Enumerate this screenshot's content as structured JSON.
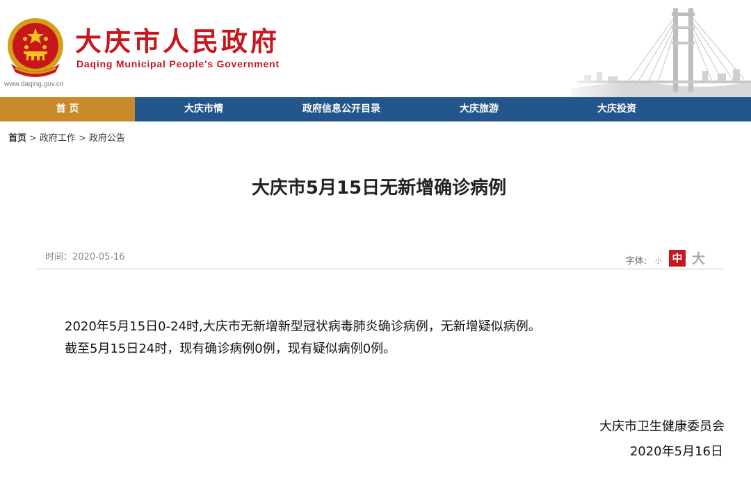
{
  "header": {
    "site_name_cn": "大庆市人民政府",
    "site_name_en": "Daqing Municipal People's Government",
    "site_url": "www.daqing.gov.cn",
    "brand_color": "#c8161d",
    "emblem_icon": "national-emblem-icon",
    "bridge_image": "bridge-illustration"
  },
  "nav": {
    "bg_color": "#23578c",
    "active_color": "#c98a2c",
    "items": [
      {
        "label": "首 页"
      },
      {
        "label": "大庆市情"
      },
      {
        "label": "政府信息公开目录"
      },
      {
        "label": "大庆旅游"
      },
      {
        "label": "大庆投资"
      }
    ]
  },
  "breadcrumb": {
    "items": [
      "首页",
      "政府工作",
      "政府公告"
    ],
    "separator": ">"
  },
  "article": {
    "title": "大庆市5月15日无新增确诊病例",
    "date_label": "时间：2020-05-16",
    "font_size_label": "字体:",
    "font_small": "小",
    "font_mid": "中",
    "font_big": "大",
    "paragraphs": [
      "2020年5月15日0-24时,大庆市无新增新型冠状病毒肺炎确诊病例，无新增疑似病例。",
      "截至5月15日24时，现有确诊病例0例，现有疑似病例0例。"
    ],
    "signature_org": "大庆市卫生健康委员会",
    "signature_date": "2020年5月16日"
  }
}
